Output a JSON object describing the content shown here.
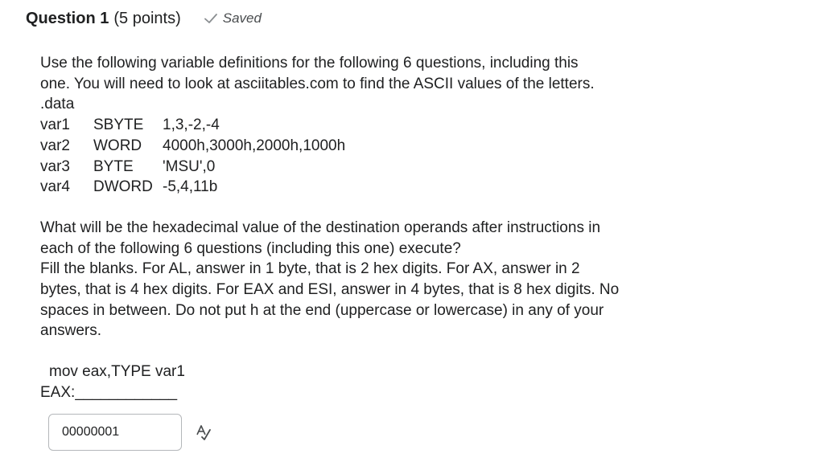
{
  "question": {
    "title": "Question 1",
    "points": "(5 points)",
    "status": {
      "icon": "checkmark-icon",
      "label": "Saved"
    }
  },
  "body": {
    "intro": [
      "Use the following variable definitions for the following 6 questions, including this",
      "one. You will need to look at asciitables.com to find the ASCII values of the letters."
    ],
    "data_directive": ".data",
    "definitions": [
      {
        "name": "var1",
        "type": "SBYTE",
        "value": "1,3,-2,-4"
      },
      {
        "name": "var2",
        "type": "WORD",
        "value": "4000h,3000h,2000h,1000h"
      },
      {
        "name": "var3",
        "type": "BYTE",
        "value": "'MSU',0"
      },
      {
        "name": "var4",
        "type": "DWORD",
        "value": "-5,4,11b"
      }
    ],
    "prompt": [
      "What will be the hexadecimal value of the destination operands after instructions in",
      "each of the following 6 questions (including this one) execute?"
    ],
    "instructions": [
      "Fill the blanks. For AL, answer in 1 byte, that is 2 hex digits. For AX, answer in 2",
      "bytes, that is 4 hex digits. For EAX and ESI, answer in 4 bytes, that is 8 hex digits. No",
      "spaces in between. Do not put h at the end (uppercase or lowercase) in any of your",
      "answers."
    ],
    "instruction_line": "mov eax,TYPE var1",
    "blank_label": "EAX:",
    "blank_line": "____________"
  },
  "answer": {
    "value": "00000001",
    "spellcheck_icon": "spellcheck-icon"
  },
  "colors": {
    "text": "#202122",
    "muted": "#494c4e",
    "check": "#8a8e91",
    "input_border": "#b4b7ba"
  }
}
